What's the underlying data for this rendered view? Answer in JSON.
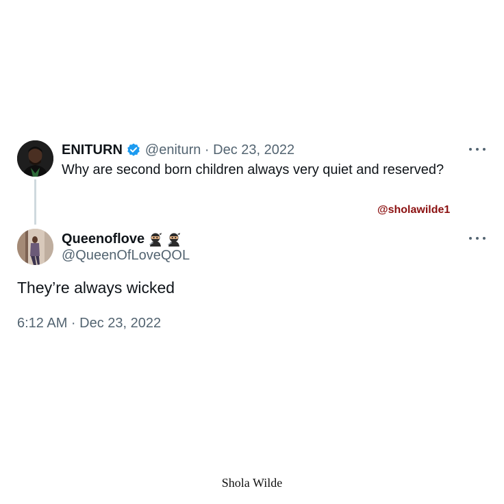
{
  "parent_tweet": {
    "display_name": "ENITURN",
    "verified": true,
    "handle": "@eniturn",
    "separator": "·",
    "date": "Dec 23, 2022",
    "text": "Why are second born children always very quiet and reserved?",
    "more_icon": "more-horizontal-icon"
  },
  "watermark": {
    "text": "@sholawilde1",
    "color": "#8b1010"
  },
  "reply_tweet": {
    "display_name": "Queenoflove",
    "name_emojis": [
      "ninja-emoji",
      "ninja-emoji"
    ],
    "handle": "@QueenOfLoveQOL",
    "text": "They’re always wicked",
    "timestamp": "6:12 AM · Dec 23, 2022",
    "more_icon": "more-horizontal-icon"
  },
  "signature": {
    "text": "Shola Wilde"
  },
  "colors": {
    "primary_text": "#0f1419",
    "secondary_text": "#536471",
    "verified_blue": "#1d9bf0",
    "thread_line": "#cfd9de"
  }
}
